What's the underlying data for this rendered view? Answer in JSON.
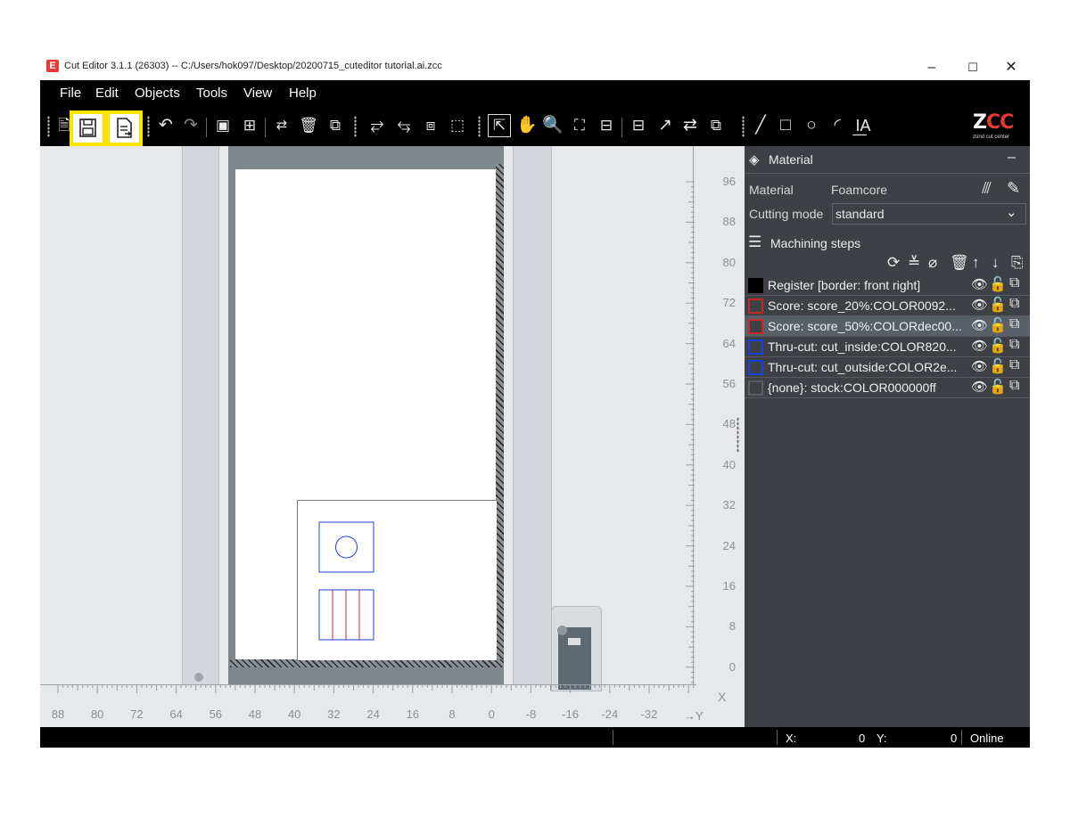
{
  "app": {
    "logo_letter": "E",
    "title": "Cut Editor 3.1.1 (26303)  --  C:/Users/hok097/Desktop/20200715_cuteditor tutorial.ai.zcc"
  },
  "window_controls": {
    "minimize": "–",
    "maximize": "☐",
    "close": "✕"
  },
  "menu": [
    "File",
    "Edit",
    "Objects",
    "Tools",
    "View",
    "Help"
  ],
  "brand": {
    "logo": "ZCC",
    "tagline": "zünd cut center"
  },
  "ruler": {
    "y_ticks": [
      "96",
      "88",
      "80",
      "72",
      "64",
      "56",
      "48",
      "40",
      "32",
      "24",
      "16",
      "8",
      "0"
    ],
    "x_ticks": [
      "88",
      "80",
      "72",
      "64",
      "56",
      "48",
      "40",
      "32",
      "24",
      "16",
      "8",
      "0",
      "-8",
      "-16",
      "-24",
      "-32"
    ],
    "x_axis_label": "X",
    "y_axis_label": "Y"
  },
  "panel": {
    "material_section": "Material",
    "collapse": "–",
    "material_label": "Material",
    "material_value": "Foamcore",
    "cutting_mode_label": "Cutting mode",
    "cutting_mode_value": "standard",
    "machining_section": "Machining steps",
    "steps": [
      {
        "color": "#000000",
        "label": "Register [border: front right]",
        "selected": false
      },
      {
        "color": "#c62828",
        "label": "Score: score_20%:COLOR0092...",
        "selected": false
      },
      {
        "color": "#c62828",
        "label": "Score: score_50%:COLORdec00...",
        "selected": true
      },
      {
        "color": "#1a3fe0",
        "label": "Thru-cut: cut_inside:COLOR820...",
        "selected": false
      },
      {
        "color": "#1a3fe0",
        "label": "Thru-cut: cut_outside:COLOR2e...",
        "selected": false
      },
      {
        "color": "#5a5e62",
        "label": "{none}: stock:COLOR000000ff",
        "selected": false
      }
    ]
  },
  "status": {
    "x_label": "X:",
    "x_value": "0",
    "y_label": "Y:",
    "y_value": "0",
    "connection": "Online"
  }
}
